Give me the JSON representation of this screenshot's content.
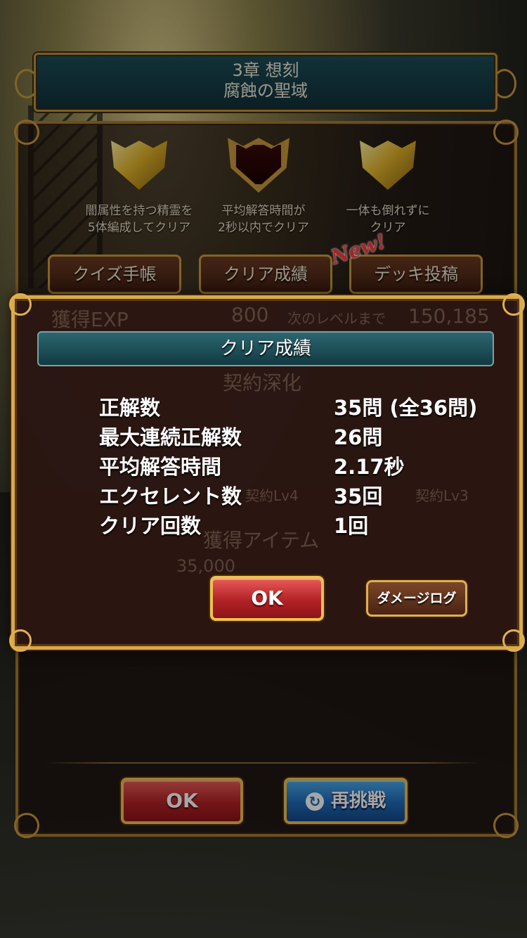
{
  "stage": {
    "chapter": "3章 想刻",
    "name": "腐蝕の聖域"
  },
  "missions": [
    {
      "text": "闇属性を持つ精霊を\n5体編成してクリア",
      "achieved": true
    },
    {
      "text": "平均解答時間が\n2秒以内でクリア",
      "achieved": false
    },
    {
      "text": "一体も倒れずに\nクリア",
      "achieved": true
    }
  ],
  "tabs": {
    "quiz_notebook": "クイズ手帳",
    "clear_results": "クリア成績",
    "deck_post": "デッキ投稿",
    "new_badge": "New!"
  },
  "behind": {
    "exp_label": "獲得EXP",
    "exp_value": "800",
    "next_level_label": "次のレベルまで",
    "next_level_value": "150,185",
    "contract_title": "契約深化",
    "contract_lv4": "契約Lv4",
    "contract_lv3": "契約Lv3",
    "items_title": "獲得アイテム",
    "gold_value": "35,000"
  },
  "dialog": {
    "title": "クリア成績",
    "stats": [
      {
        "label": "正解数",
        "value": "35問 (全36問)"
      },
      {
        "label": "最大連続正解数",
        "value": "26問"
      },
      {
        "label": "平均解答時間",
        "value": "2.17秒"
      },
      {
        "label": "エクセレント数",
        "value": "35回"
      },
      {
        "label": "クリア回数",
        "value": "1回"
      }
    ],
    "ok_label": "OK",
    "damage_log_label": "ダメージログ"
  },
  "footer": {
    "ok_label": "OK",
    "retry_label": "再挑戦"
  }
}
